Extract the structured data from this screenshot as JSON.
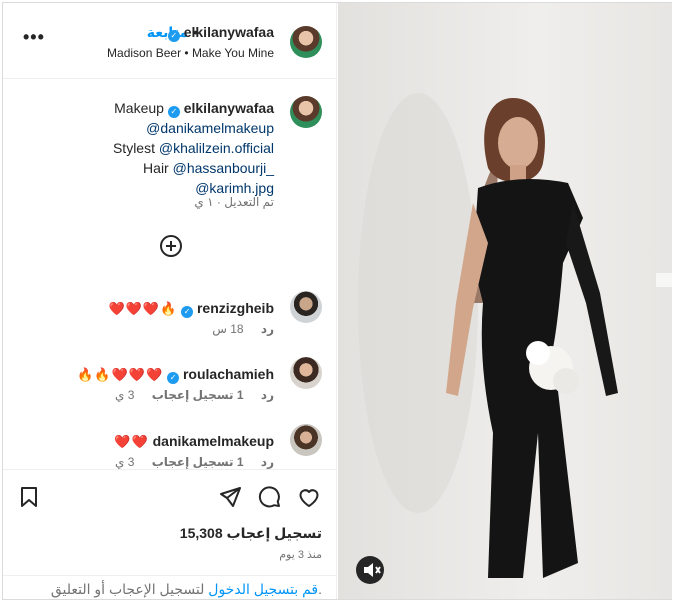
{
  "header": {
    "username": "elkilanywafaa",
    "follow_label": "متابعة",
    "separator": "•",
    "audio": "Madison Beer • Make You Mine",
    "more_label": "•••"
  },
  "caption": {
    "username": "elkilanywafaa",
    "lines": [
      "Makeup",
      "@danikamelmakeup",
      "Stylest",
      "@khalilzein.official",
      "Hair",
      "@hassanbourji_",
      "@karimh.jpg"
    ],
    "edited": "تم التعديل · ١ ي"
  },
  "comments": [
    {
      "username": "renzizgheib",
      "text": "❤️❤️❤️🔥",
      "time": "18 س",
      "reply": "رد",
      "likes": ""
    },
    {
      "username": "roulachamieh",
      "text": "🔥🔥❤️❤️❤️",
      "time": "3 ي",
      "reply": "رد",
      "likes": "1 تسجيل إعجاب"
    },
    {
      "username": "danikamelmakeup",
      "text": "❤️❤️",
      "time": "3 ي",
      "reply": "رد",
      "likes": "1 تسجيل إعجاب"
    }
  ],
  "footer": {
    "likes": "15,308 تسجيل إعجاب",
    "time": "منذ 3 يوم",
    "login_link": "قم بتسجيل الدخول",
    "login_rest": " لتسجيل الإعجاب أو التعليق."
  },
  "icons": {
    "verified": "verified-badge-icon",
    "like": "heart-outline-icon",
    "comment": "comment-bubble-icon",
    "share": "paper-plane-icon",
    "save": "bookmark-icon",
    "add": "plus-circle-icon",
    "mute": "speaker-muted-icon"
  },
  "colors": {
    "accent": "#0095f6",
    "verified": "#1d9bf0",
    "muted": "#737373",
    "link": "#00376b",
    "heart": "#ed4956"
  }
}
